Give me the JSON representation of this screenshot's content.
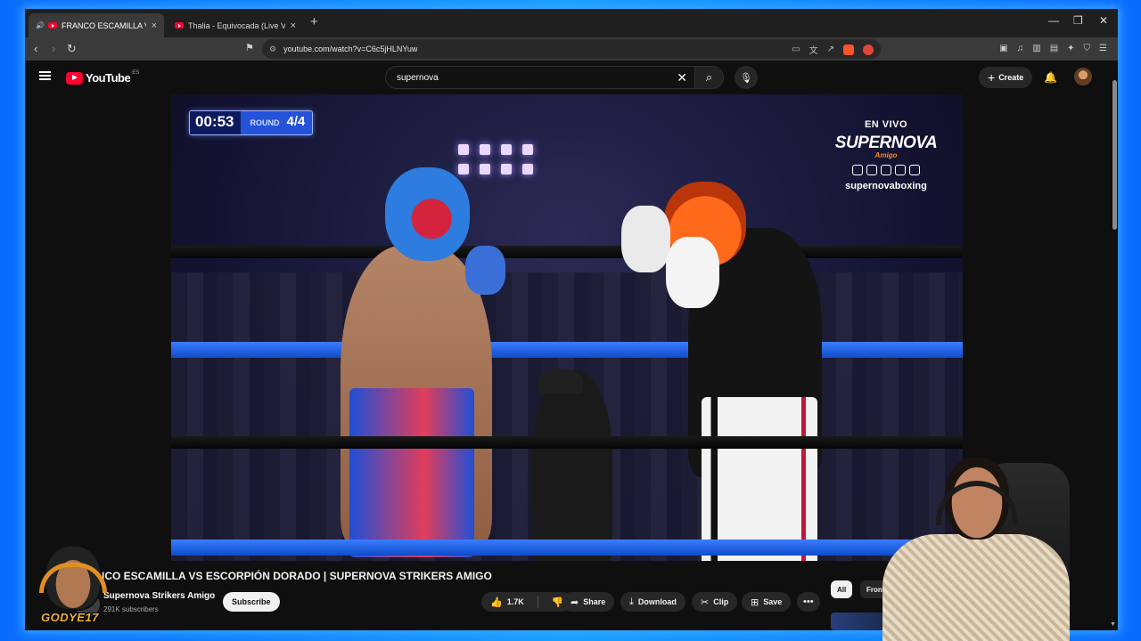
{
  "browser": {
    "tabs": [
      {
        "label": "FRANCO ESCAMILLA VS ESCO",
        "active": true,
        "audio": true
      },
      {
        "label": "Thalia - Equivocada (Live Version) - Y",
        "active": false,
        "audio": false
      }
    ],
    "new_tab_icon": "plus-icon",
    "url": "youtube.com/watch?v=C6c5jHLNYuw"
  },
  "youtube": {
    "logo_text": "YouTube",
    "country_code": "ES",
    "search_query": "supernova",
    "create_label": "Create"
  },
  "video": {
    "timer": "00:53",
    "round_label": "ROUND",
    "round_value": "4/4",
    "live_label": "EN VIVO",
    "brand": "SUPERNOVA",
    "brand_sub": "Amigo",
    "social_handle": "supernovaboxing"
  },
  "details": {
    "title": "ANCO ESCAMILLA VS ESCORPIÓN DORADO | SUPERNOVA STRIKERS AMIGO",
    "channel_name": "Supernova Strikers Amigo",
    "subscribers": "291K subscribers",
    "subscribe_label": "Subscribe",
    "likes": "1.7K",
    "share_label": "Share",
    "download_label": "Download",
    "clip_label": "Clip",
    "save_label": "Save"
  },
  "related_chips": [
    {
      "label": "All",
      "selected": true
    },
    {
      "label": "Fron",
      "selected": false
    }
  ],
  "streamer_logo_text": "GODYE17",
  "colors": {
    "frame_glow": "#18a0ff",
    "youtube_red": "#ff0033",
    "scorebug_dark": "#0d1b5e",
    "scorebug_blue": "#2452d9"
  }
}
